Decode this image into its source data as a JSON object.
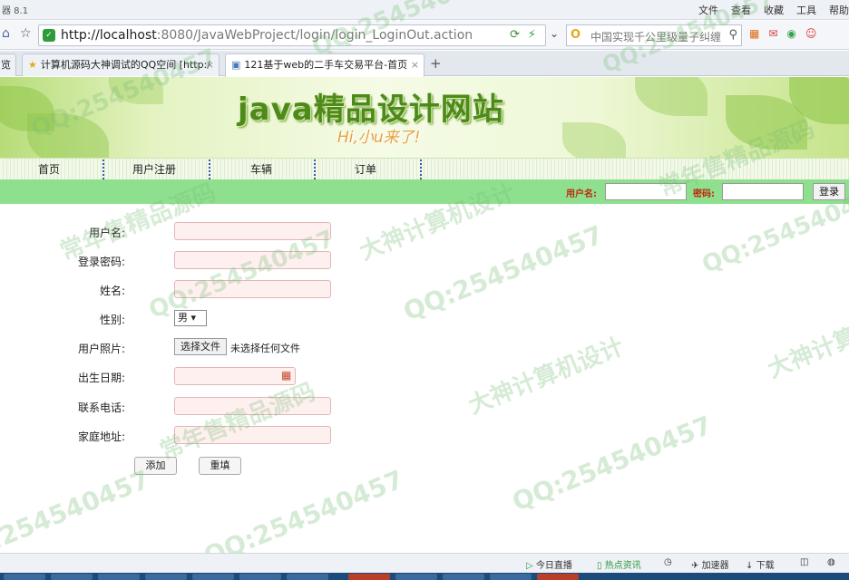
{
  "browser": {
    "app_title": "器 8.1",
    "menu": [
      "文件",
      "查看",
      "收藏",
      "工具",
      "帮助"
    ],
    "url_host": "http://localhost",
    "url_rest": ":8080/JavaWebProject/login/login_LoginOut.action",
    "search_text": "中国实现千公里级量子纠缠",
    "tabs": [
      {
        "label": "览"
      },
      {
        "label": "计算机源码大神调试的QQ空间 [http:/"
      },
      {
        "label": "121基于web的二手车交易平台-首页"
      }
    ]
  },
  "site": {
    "title": "java精品设计网站",
    "slogan": "Hi,小u来了!"
  },
  "nav": [
    "首页",
    "用户注册",
    "车辆",
    "订单"
  ],
  "login": {
    "username_label": "用户名:",
    "password_label": "密码:",
    "login_button": "登录"
  },
  "form": {
    "username_label": "用户名:",
    "password_label": "登录密码:",
    "name_label": "姓名:",
    "gender_label": "性别:",
    "gender_value": "男 ▾",
    "photo_label": "用户照片:",
    "file_button": "选择文件",
    "file_status": "未选择任何文件",
    "birthday_label": "出生日期:",
    "phone_label": "联系电话:",
    "address_label": "家庭地址:",
    "add_button": "添加",
    "reset_button": "重填"
  },
  "watermarks": [
    "QQ:254540457",
    "常年售精品源码",
    "大神计算机设计"
  ],
  "statusbar": [
    "今日直播",
    "热点资讯",
    "加速器",
    "下载"
  ]
}
